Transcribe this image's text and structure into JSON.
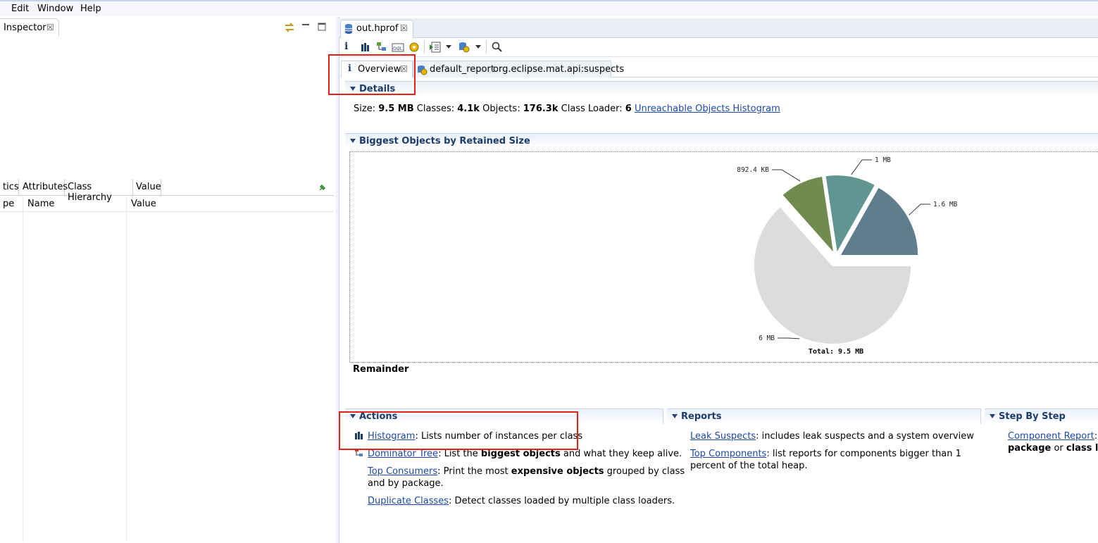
{
  "menu": [
    "Edit",
    "Window",
    "Help"
  ],
  "left_panel": {
    "title": "Inspector",
    "tabs": [
      "tics",
      "Attributes",
      "Class Hierarchy",
      "Value"
    ],
    "columns": [
      "pe",
      "Name",
      "Value"
    ]
  },
  "editor": {
    "tab_title": "out.hprof"
  },
  "subtabs": {
    "overview": "Overview",
    "report_name": "default_report",
    "report_id": "org.eclipse.mat.api:suspects"
  },
  "details": {
    "title": "Details",
    "size_label": "Size:",
    "size_value": "9.5 MB",
    "classes_label": "Classes:",
    "classes_value": "4.1k",
    "objects_label": "Objects:",
    "objects_value": "176.3k",
    "loader_label": "Class Loader:",
    "loader_value": "6",
    "unreachable_link": "Unreachable Objects Histogram"
  },
  "biggest": {
    "title": "Biggest Objects by Retained Size",
    "remainder_label": "Remainder"
  },
  "chart_data": {
    "type": "pie",
    "slices": [
      {
        "label": "1.6 MB",
        "value": 1.6,
        "color": "#5f7d8d"
      },
      {
        "label": "1 MB",
        "value": 1.0,
        "color": "#609692"
      },
      {
        "label": "892.4 KB",
        "value": 0.8715,
        "color": "#6f8b4e"
      },
      {
        "label": "6 MB",
        "value": 6.0287,
        "color": "#dcdcdc",
        "exploded": true
      }
    ],
    "total_label": "Total: 9.5 MB"
  },
  "actions": {
    "title": "Actions",
    "items": [
      {
        "link": "Histogram",
        "text": ": Lists number of instances per class"
      },
      {
        "link": "Dominator Tree",
        "text": ": List the ",
        "bold": "biggest objects",
        "text2": " and what they keep alive."
      },
      {
        "link": "Top Consumers",
        "text": ": Print the most ",
        "bold": "expensive objects",
        "text2": " grouped by class",
        "line2": "and by package."
      },
      {
        "link": "Duplicate Classes",
        "text": ": Detect classes loaded by multiple class loaders."
      }
    ]
  },
  "reports": {
    "title": "Reports",
    "items": [
      {
        "link": "Leak Suspects",
        "text": ": includes leak suspects and a system overview"
      },
      {
        "link": "Top Components",
        "text": ": list reports for components bigger than 1",
        "line2": "percent of the total heap."
      }
    ]
  },
  "step": {
    "title": "Step By Step",
    "link": "Component Report",
    "text": ": A",
    "bold1": "package",
    "text2": " or ",
    "bold2": "class load"
  },
  "colors": {
    "accent": "#1c3c6b",
    "highlight": "#e2231a",
    "link": "#1c4aa8"
  }
}
